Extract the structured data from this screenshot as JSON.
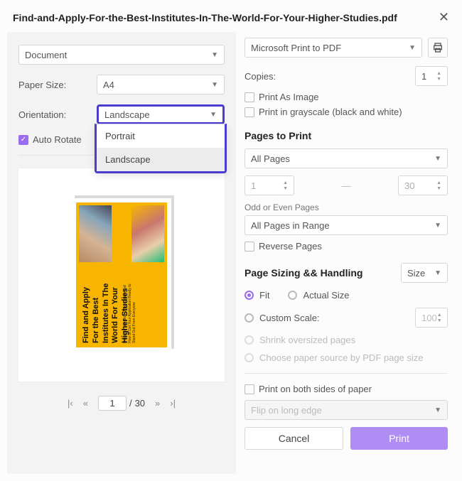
{
  "title": "Find-and-Apply-For-the-Best-Institutes-In-The-World-For-Your-Higher-Studies.pdf",
  "left": {
    "mode": "Document",
    "paper_size_label": "Paper Size:",
    "paper_size": "A4",
    "orientation_label": "Orientation:",
    "orientation_value": "Landscape",
    "orientation_options": [
      "Portrait",
      "Landscape"
    ],
    "auto_rotate": "Auto Rotate",
    "pager": {
      "current": "1",
      "sep": "/",
      "total": "30"
    },
    "doc_title": "Find and Apply For the Best Institutes In The World For Your Higher Studies",
    "doc_sub": "Discover The Best Opportunities and How to Get Your Application Ready to Stand Out From Everyone"
  },
  "right": {
    "printer": "Microsoft Print to PDF",
    "copies_label": "Copies:",
    "copies": "1",
    "print_as_image": "Print As Image",
    "grayscale": "Print in grayscale (black and white)",
    "pages_to_print": "Pages to Print",
    "page_range_select": "All Pages",
    "range_from": "1",
    "range_to": "30",
    "odd_even_label": "Odd or Even Pages",
    "odd_even_value": "All Pages in Range",
    "reverse": "Reverse Pages",
    "sizing_header": "Page Sizing && Handling",
    "size_select": "Size",
    "fit": "Fit",
    "actual": "Actual Size",
    "custom_scale": "Custom Scale:",
    "custom_scale_val": "100",
    "shrink": "Shrink oversized pages",
    "choose_source": "Choose paper source by PDF page size",
    "duplex": "Print on both sides of paper",
    "flip": "Flip on long edge",
    "cancel": "Cancel",
    "print": "Print"
  }
}
